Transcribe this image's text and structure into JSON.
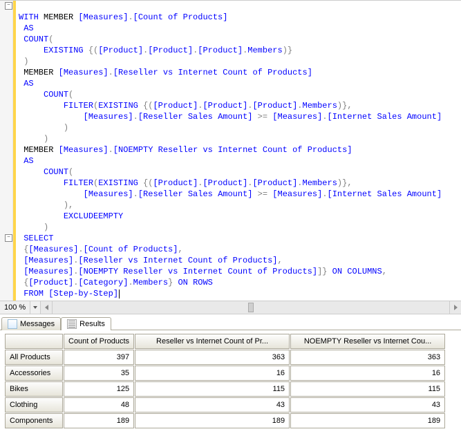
{
  "code": {
    "line1_kw": "WITH",
    "line1a": " MEMBER ",
    "line1_m1": "[Measures]",
    "line1_m2": "[Count of Products]",
    "line2_as": "AS",
    "line3_count": "COUNT",
    "line4_existing": "EXISTING ",
    "line4_b1": "[Product]",
    "line4_b2": "[Product]",
    "line4_b3": "[Product]",
    "line4_mem": "Members",
    "line6_member": "MEMBER ",
    "line6_m1": "[Measures]",
    "line6_m2": "[Reseller vs Internet Count of Products]",
    "line7_as": "AS",
    "line8_count": "COUNT",
    "line9_filter": "FILTER",
    "line9_existing": "EXISTING ",
    "line9_b1": "[Product]",
    "line9_b2": "[Product]",
    "line9_b3": "[Product]",
    "line9_mem": "Members",
    "line10_m1": "[Measures]",
    "line10_m2": "[Reseller Sales Amount]",
    "line10_m3": "[Measures]",
    "line10_m4": "[Internet Sales Amount]",
    "line13_member": "MEMBER ",
    "line13_m1": "[Measures]",
    "line13_m2": "[NOEMPTY Reseller vs Internet Count of Products]",
    "line14_as": "AS",
    "line15_count": "COUNT",
    "line16_filter": "FILTER",
    "line16_existing": "EXISTING ",
    "line16_b1": "[Product]",
    "line16_b2": "[Product]",
    "line16_b3": "[Product]",
    "line16_mem": "Members",
    "line17_m1": "[Measures]",
    "line17_m2": "[Reseller Sales Amount]",
    "line17_m3": "[Measures]",
    "line17_m4": "[Internet Sales Amount]",
    "line19_excl": "EXCLUDEEMPTY",
    "line21_select": "SELECT",
    "line22_m1": "[Measures]",
    "line22_m2": "[Count of Products]",
    "line23_m1": "[Measures]",
    "line23_m2": "[Reseller vs Internet Count of Products]",
    "line24_m1": "[Measures]",
    "line24_m2": "[NOEMPTY Reseller vs Internet Count of Products]",
    "line24_on": " ON COLUMNS",
    "line25_b1": "[Product]",
    "line25_b2": "[Category]",
    "line25_mem": "Members",
    "line25_on": " ON ROWS",
    "line26_from": "FROM ",
    "line26_cube": "[Step-by-Step]"
  },
  "zoom": {
    "pct": "100 %"
  },
  "tabs": {
    "messages": "Messages",
    "results": "Results"
  },
  "grid": {
    "col0": "",
    "col1": "Count of Products",
    "col2": "Reseller vs Internet Count of Pr...",
    "col3": "NOEMPTY Reseller vs Internet Cou...",
    "rows": [
      {
        "label": "All Products",
        "c1": "397",
        "c2": "363",
        "c3": "363"
      },
      {
        "label": "Accessories",
        "c1": "35",
        "c2": "16",
        "c3": "16"
      },
      {
        "label": "Bikes",
        "c1": "125",
        "c2": "115",
        "c3": "115"
      },
      {
        "label": "Clothing",
        "c1": "48",
        "c2": "43",
        "c3": "43"
      },
      {
        "label": "Components",
        "c1": "189",
        "c2": "189",
        "c3": "189"
      }
    ]
  }
}
